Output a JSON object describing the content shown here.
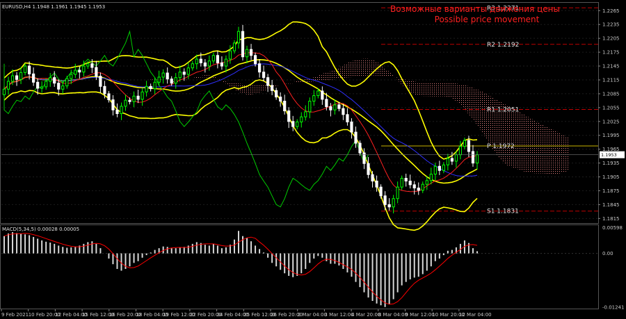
{
  "symbol_header": "EURUSD,H4  1.1948 1.1961 1.1945 1.1953",
  "macd_header": "MACD(5,34,5) 0.00028 0.00005",
  "annotation": {
    "line1": "Возможные варианты движения цены",
    "line2": "Possible price movement"
  },
  "current_price": "1.1953",
  "colors": {
    "background": "#000000",
    "bull_candle": "#00ff00",
    "bear_candle": "#ffffff",
    "bollinger": "#ffff00",
    "chikou": "#00cc00",
    "tenkan": "#ff2020",
    "kijun": "#3030ff",
    "kumo": "#ff9090",
    "pivot_line": "#c8b400",
    "resistance": "#c00000",
    "support": "#c00000",
    "macd_hist": "#d8d8d8",
    "macd_signal": "#ff0000",
    "annotation": "#ff2020",
    "price_tag": "#ffffff"
  },
  "chart_data": {
    "type": "candlestick",
    "price_axis": {
      "ticks": [
        "1.2265",
        "1.2235",
        "1.2205",
        "1.2175",
        "1.2145",
        "1.2115",
        "1.2085",
        "1.2055",
        "1.2025",
        "1.1995",
        "1.1965",
        "1.1935",
        "1.1905",
        "1.1875",
        "1.1845",
        "1.1815"
      ],
      "range": [
        1.1805,
        1.2282
      ]
    },
    "macd_axis": {
      "ticks": [
        "0.00598",
        "0.00",
        "-0.01241"
      ],
      "range": [
        -0.0126,
        0.0062
      ]
    },
    "time_axis": [
      "9 Feb 2021",
      "10 Feb 20:00",
      "12 Feb 04:00",
      "15 Feb 12:00",
      "16 Feb 20:00",
      "18 Feb 04:00",
      "19 Feb 12:00",
      "22 Feb 20:00",
      "24 Feb 04:00",
      "25 Feb 12:00",
      "26 Feb 20:00",
      "2 Mar 04:00",
      "3 Mar 12:00",
      "4 Mar 20:00",
      "8 Mar 04:00",
      "9 Mar 12:00",
      "10 Mar 20:00",
      "12 Mar 04:00"
    ],
    "levels": [
      {
        "name": "R3",
        "value": 1.2271,
        "label": "R3  1.2271"
      },
      {
        "name": "R2",
        "value": 1.2192,
        "label": "R2  1.2192"
      },
      {
        "name": "R1",
        "value": 1.2051,
        "label": "R1  1.2051"
      },
      {
        "name": "P",
        "value": 1.1972,
        "label": "P  1.1972"
      },
      {
        "name": "S1",
        "value": 1.1831,
        "label": "S1  1.1831"
      }
    ],
    "closes": [
      1.2095,
      1.2112,
      1.2124,
      1.2116,
      1.2131,
      1.2145,
      1.2128,
      1.211,
      1.2097,
      1.21,
      1.2112,
      1.212,
      1.2108,
      1.2095,
      1.2102,
      1.2118,
      1.2127,
      1.2136,
      1.2132,
      1.2145,
      1.215,
      1.2142,
      1.2123,
      1.2101,
      1.2085,
      1.2072,
      1.205,
      1.2042,
      1.2058,
      1.2071,
      1.2068,
      1.208,
      1.2073,
      1.2089,
      1.2101,
      1.2096,
      1.211,
      1.2121,
      1.213,
      1.2117,
      1.2108,
      1.212,
      1.2132,
      1.2127,
      1.2141,
      1.215,
      1.216,
      1.2152,
      1.2145,
      1.2156,
      1.2168,
      1.2152,
      1.2145,
      1.216,
      1.2178,
      1.2195,
      1.222,
      1.2165,
      1.2181,
      1.2168,
      1.215,
      1.2132,
      1.212,
      1.2103,
      1.2092,
      1.2078,
      1.2069,
      1.2048,
      1.2025,
      1.2014,
      1.2024,
      1.2035,
      1.2046,
      1.2069,
      1.2081,
      1.2091,
      1.2073,
      1.2057,
      1.205,
      1.2061,
      1.2053,
      1.204,
      1.2024,
      1.2002,
      1.1978,
      1.1957,
      1.1934,
      1.191,
      1.1896,
      1.1883,
      1.1864,
      1.1845,
      1.184,
      1.1858,
      1.1883,
      1.1902,
      1.1896,
      1.1888,
      1.1881,
      1.1876,
      1.1889,
      1.1897,
      1.1911,
      1.1928,
      1.1919,
      1.1931,
      1.1945,
      1.1939,
      1.1953,
      1.1971,
      1.1984,
      1.196,
      1.1935,
      1.1953
    ],
    "macd_hist": [
      0.004,
      0.0046,
      0.0049,
      0.0047,
      0.0046,
      0.0044,
      0.0042,
      0.0038,
      0.0034,
      0.003,
      0.0027,
      0.0025,
      0.0022,
      0.0018,
      0.0015,
      0.0013,
      0.0014,
      0.0016,
      0.0018,
      0.0022,
      0.0026,
      0.0028,
      0.0022,
      0.0012,
      0.0,
      -0.0012,
      -0.0025,
      -0.0036,
      -0.004,
      -0.0036,
      -0.003,
      -0.0022,
      -0.0018,
      -0.001,
      -0.0004,
      0.0002,
      0.0008,
      0.0012,
      0.0016,
      0.0015,
      0.0012,
      0.0012,
      0.0014,
      0.0015,
      0.0018,
      0.0022,
      0.0026,
      0.0024,
      0.002,
      0.0018,
      0.0022,
      0.0018,
      0.0012,
      0.0014,
      0.002,
      0.0032,
      0.0052,
      0.004,
      0.0036,
      0.0028,
      0.0018,
      0.001,
      0.0002,
      -0.001,
      -0.0022,
      -0.003,
      -0.0038,
      -0.0046,
      -0.0052,
      -0.0055,
      -0.0052,
      -0.0046,
      -0.0036,
      -0.0022,
      -0.0012,
      -0.0006,
      -0.001,
      -0.0018,
      -0.0024,
      -0.0024,
      -0.0028,
      -0.0036,
      -0.0044,
      -0.0054,
      -0.0066,
      -0.0078,
      -0.009,
      -0.0102,
      -0.011,
      -0.0116,
      -0.012,
      -0.0124,
      -0.0118,
      -0.0106,
      -0.009,
      -0.0074,
      -0.0066,
      -0.006,
      -0.0056,
      -0.0054,
      -0.0048,
      -0.004,
      -0.003,
      -0.0018,
      -0.0012,
      -0.0004,
      0.0006,
      0.0008,
      0.0014,
      0.0022,
      0.003,
      0.0024,
      0.0012,
      0.0005
    ]
  }
}
